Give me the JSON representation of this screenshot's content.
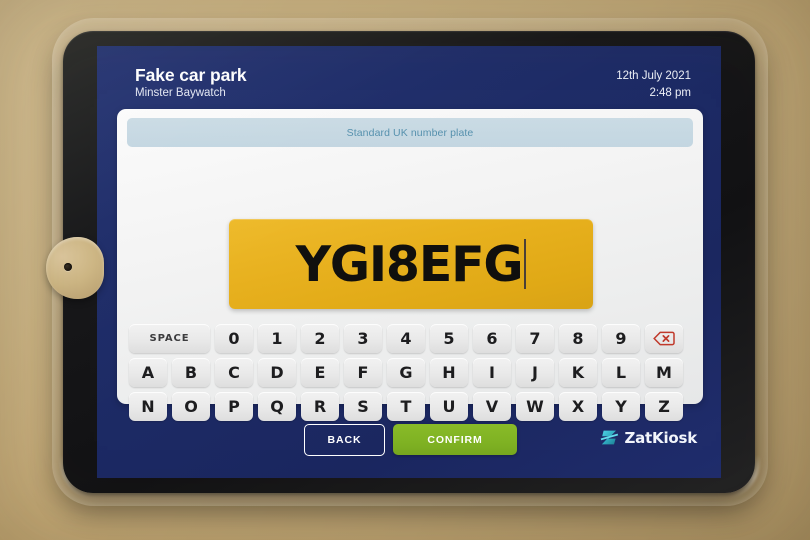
{
  "header": {
    "site_title": "Fake car park",
    "site_subtitle": "Minster Baywatch",
    "date": "12th July 2021",
    "time": "2:48 pm"
  },
  "form": {
    "hint": "Standard UK number plate",
    "plate_value": "YGI8EFG",
    "plate_placeholder": "",
    "plate_bg": "#e7b01d",
    "plate_text_color": "#100f0d"
  },
  "keyboard": {
    "rows": [
      {
        "keys": [
          {
            "label": "SPACE",
            "name": "key-space",
            "type": "wide"
          },
          {
            "label": "0",
            "name": "key-0",
            "type": "normal"
          },
          {
            "label": "1",
            "name": "key-1",
            "type": "normal"
          },
          {
            "label": "2",
            "name": "key-2",
            "type": "normal"
          },
          {
            "label": "3",
            "name": "key-3",
            "type": "normal"
          },
          {
            "label": "4",
            "name": "key-4",
            "type": "normal"
          },
          {
            "label": "5",
            "name": "key-5",
            "type": "normal"
          },
          {
            "label": "6",
            "name": "key-6",
            "type": "normal"
          },
          {
            "label": "7",
            "name": "key-7",
            "type": "normal"
          },
          {
            "label": "8",
            "name": "key-8",
            "type": "normal"
          },
          {
            "label": "9",
            "name": "key-9",
            "type": "normal"
          },
          {
            "label": "",
            "name": "key-backspace",
            "type": "backspace",
            "icon": "backspace-icon"
          }
        ]
      },
      {
        "keys": [
          {
            "label": "A",
            "name": "key-a",
            "type": "normal"
          },
          {
            "label": "B",
            "name": "key-b",
            "type": "normal"
          },
          {
            "label": "C",
            "name": "key-c",
            "type": "normal"
          },
          {
            "label": "D",
            "name": "key-d",
            "type": "normal"
          },
          {
            "label": "E",
            "name": "key-e",
            "type": "normal"
          },
          {
            "label": "F",
            "name": "key-f",
            "type": "normal"
          },
          {
            "label": "G",
            "name": "key-g",
            "type": "normal"
          },
          {
            "label": "H",
            "name": "key-h",
            "type": "normal"
          },
          {
            "label": "I",
            "name": "key-i",
            "type": "normal"
          },
          {
            "label": "J",
            "name": "key-j",
            "type": "normal"
          },
          {
            "label": "K",
            "name": "key-k",
            "type": "normal"
          },
          {
            "label": "L",
            "name": "key-l",
            "type": "normal"
          },
          {
            "label": "M",
            "name": "key-m",
            "type": "normal"
          }
        ]
      },
      {
        "keys": [
          {
            "label": "N",
            "name": "key-n",
            "type": "normal"
          },
          {
            "label": "O",
            "name": "key-o",
            "type": "normal"
          },
          {
            "label": "P",
            "name": "key-p",
            "type": "normal"
          },
          {
            "label": "Q",
            "name": "key-q",
            "type": "normal"
          },
          {
            "label": "R",
            "name": "key-r",
            "type": "normal"
          },
          {
            "label": "S",
            "name": "key-s",
            "type": "normal"
          },
          {
            "label": "T",
            "name": "key-t",
            "type": "normal"
          },
          {
            "label": "U",
            "name": "key-u",
            "type": "normal"
          },
          {
            "label": "V",
            "name": "key-v",
            "type": "normal"
          },
          {
            "label": "W",
            "name": "key-w",
            "type": "normal"
          },
          {
            "label": "X",
            "name": "key-x",
            "type": "normal"
          },
          {
            "label": "Y",
            "name": "key-y",
            "type": "normal"
          },
          {
            "label": "Z",
            "name": "key-z",
            "type": "normal"
          }
        ]
      }
    ]
  },
  "footer": {
    "back_label": "BACK",
    "confirm_label": "CONFIRM",
    "confirm_color": "#7fb223",
    "brand_name": "ZatKiosk",
    "brand_mark_color": "#31b6c9"
  },
  "theme": {
    "screen_navy": "#1d2b66",
    "hint_bar": "#c6d8e2",
    "hint_text": "#5590ad",
    "backspace_red": "#c0392b"
  }
}
